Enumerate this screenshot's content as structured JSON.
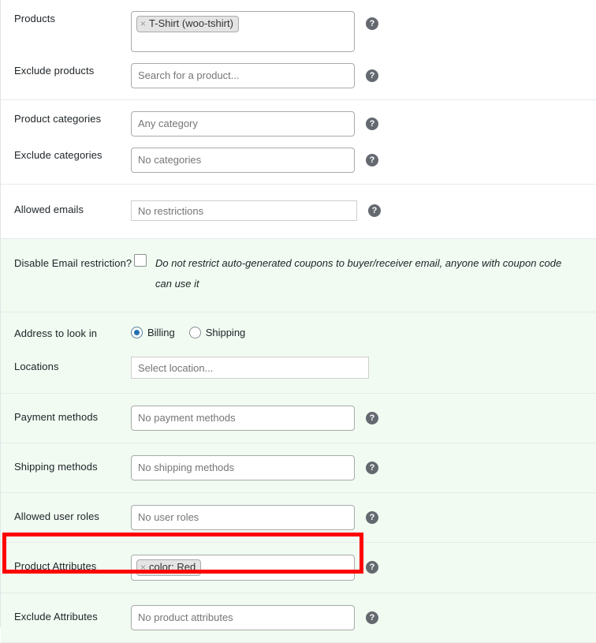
{
  "groups": [
    {
      "shaded": false,
      "rows": [
        {
          "label": "Products",
          "control": "multiselect_tall",
          "chips": [
            {
              "remove_icon": "×",
              "text": "T-Shirt (woo-tshirt)"
            }
          ],
          "placeholder": "",
          "help_icon": "?"
        },
        {
          "label": "Exclude products",
          "control": "multiselect",
          "chips": [],
          "placeholder": "Search for a product...",
          "help_icon": "?"
        }
      ]
    },
    {
      "shaded": false,
      "rows": [
        {
          "label": "Product categories",
          "control": "multiselect",
          "chips": [],
          "placeholder": "Any category",
          "help_icon": "?"
        },
        {
          "label": "Exclude categories",
          "control": "multiselect",
          "chips": [],
          "placeholder": "No categories",
          "help_icon": "?"
        }
      ]
    },
    {
      "shaded": false,
      "rows": [
        {
          "label": "Allowed emails",
          "control": "textinput_emails",
          "placeholder": "No restrictions",
          "help_icon": "?"
        }
      ]
    },
    {
      "shaded": true,
      "rows": [
        {
          "label": "Disable Email restriction?",
          "control": "checkbox",
          "checked": false,
          "description": "Do not restrict auto-generated coupons to buyer/receiver email, anyone with coupon code can use it"
        }
      ]
    },
    {
      "shaded": true,
      "rows": [
        {
          "label": "Address to look in",
          "control": "radios",
          "options": [
            {
              "label": "Billing",
              "selected": true
            },
            {
              "label": "Shipping",
              "selected": false
            }
          ]
        },
        {
          "label": "Locations",
          "control": "textinput_locations",
          "placeholder": "Select location..."
        }
      ]
    },
    {
      "shaded": true,
      "rows": [
        {
          "label": "Payment methods",
          "control": "multiselect",
          "chips": [],
          "placeholder": "No payment methods",
          "help_icon": "?"
        }
      ]
    },
    {
      "shaded": true,
      "rows": [
        {
          "label": "Shipping methods",
          "control": "multiselect",
          "chips": [],
          "placeholder": "No shipping methods",
          "help_icon": "?"
        }
      ]
    },
    {
      "shaded": true,
      "rows": [
        {
          "label": "Allowed user roles",
          "control": "multiselect",
          "chips": [],
          "placeholder": "No user roles",
          "help_icon": "?"
        }
      ]
    },
    {
      "shaded": true,
      "highlighted": true,
      "rows": [
        {
          "label": "Product Attributes",
          "control": "multiselect",
          "chips": [
            {
              "remove_icon": "×",
              "text": "color: Red"
            }
          ],
          "placeholder": "",
          "help_icon": "?"
        }
      ]
    },
    {
      "shaded": true,
      "rows": [
        {
          "label": "Exclude Attributes",
          "control": "multiselect",
          "chips": [],
          "placeholder": "No product attributes",
          "help_icon": "?"
        }
      ]
    }
  ],
  "annotation": {
    "type": "red-highlight-rectangle",
    "color": "#ff0000",
    "targets_row_label": "Product Attributes"
  }
}
